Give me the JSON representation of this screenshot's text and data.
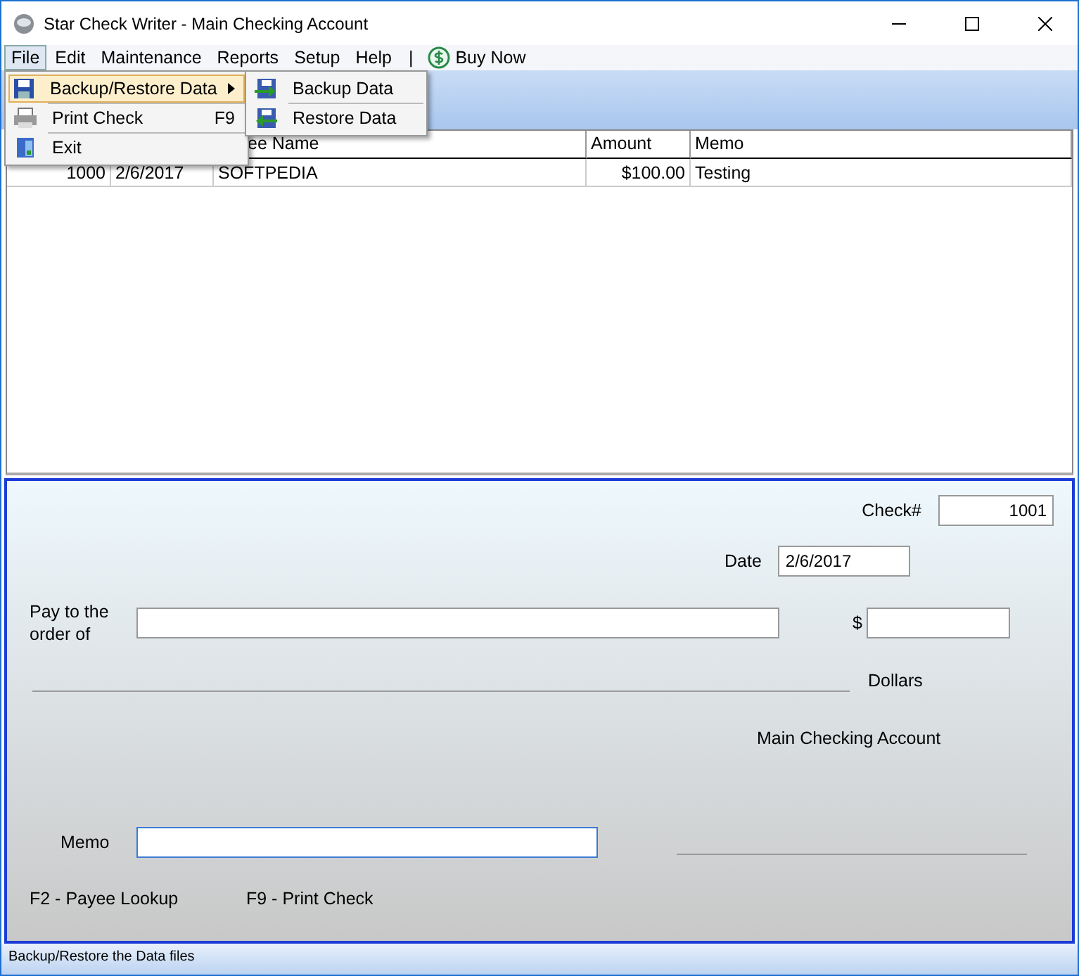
{
  "window": {
    "title": "Star Check Writer - Main Checking Account"
  },
  "menu_bar": [
    {
      "label": "File",
      "selected": true
    },
    {
      "label": "Edit",
      "selected": false
    },
    {
      "label": "Maintenance",
      "selected": false
    },
    {
      "label": "Reports",
      "selected": false
    },
    {
      "label": "Setup",
      "selected": false
    },
    {
      "label": "Help",
      "selected": false
    }
  ],
  "menu_separator": "|",
  "buy_now": {
    "label": "Buy Now"
  },
  "file_menu": {
    "items": [
      {
        "label": "Backup/Restore Data",
        "selected": true,
        "has_submenu": true
      },
      {
        "label": "Print Check",
        "shortcut": "F9",
        "selected": false,
        "has_submenu": false
      },
      {
        "label": "Exit",
        "selected": false,
        "has_submenu": false
      }
    ]
  },
  "submenu": {
    "items": [
      {
        "label": "Backup Data"
      },
      {
        "label": "Restore Data"
      }
    ]
  },
  "table": {
    "columns": [
      "",
      "",
      "ee Name",
      "Amount",
      "Memo"
    ],
    "rows": [
      {
        "cells": [
          "1000",
          "2/6/2017",
          "SOFTPEDIA",
          "$100.00",
          "Testing"
        ]
      }
    ]
  },
  "check": {
    "check_number_label": "Check#",
    "check_number": "1001",
    "date_label": "Date",
    "date": "2/6/2017",
    "pay_label": "Pay to the order of",
    "dollar_sign": "$",
    "dollars_label": "Dollars",
    "account_name": "Main Checking Account",
    "memo_label": "Memo",
    "shortcuts": [
      "F2 - Payee Lookup",
      "F9 - Print Check"
    ]
  },
  "status_bar": {
    "text": "Backup/Restore the Data files"
  }
}
